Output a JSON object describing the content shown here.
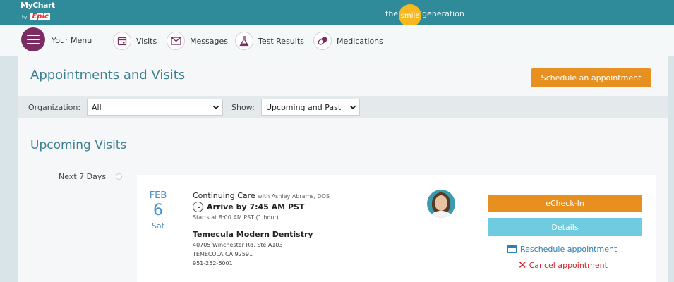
{
  "header": {
    "logo_mychart": "MyChart",
    "logo_by": "by",
    "logo_epic": "Epic",
    "brand_before": "the",
    "brand_smile": "smile",
    "brand_after": "generation"
  },
  "nav": {
    "menu_label": "Your Menu",
    "items": [
      {
        "label": "Visits",
        "icon": "calendar-icon"
      },
      {
        "label": "Messages",
        "icon": "envelope-icon"
      },
      {
        "label": "Test Results",
        "icon": "flask-icon"
      },
      {
        "label": "Medications",
        "icon": "pill-icon"
      }
    ]
  },
  "page": {
    "title": "Appointments and Visits",
    "schedule_button": "Schedule an appointment"
  },
  "filters": {
    "organization_label": "Organization:",
    "organization_value": "All",
    "show_label": "Show:",
    "show_value": "Upcoming and Past"
  },
  "upcoming": {
    "title": "Upcoming Visits",
    "timeline_label": "Next 7 Days"
  },
  "appointment": {
    "month": "FEB",
    "day": "6",
    "weekday": "Sat",
    "visit_type": "Continuing Care",
    "with_text": "with Ashley Abrams, DDS",
    "arrive": "Arrive by 7:45 AM PST",
    "starts": "Starts at 8:00 AM PST (1 hour)",
    "location_name": "Temecula Modern Dentistry",
    "address_line1": "40705 Winchester Rd, Ste A103",
    "address_line2": "TEMECULA CA 92591",
    "phone": "951-252-6001",
    "echeckin_button": "eCheck-In",
    "details_button": "Details",
    "reschedule_link": "Reschedule appointment",
    "cancel_link": "Cancel appointment"
  },
  "colors": {
    "header_teal": "#2f8a9a",
    "menu_purple": "#7b2c62",
    "accent_orange": "#e8901f",
    "details_blue": "#6ecbe0",
    "title_teal": "#3c7f93",
    "date_blue": "#4a90c8",
    "link_blue": "#2c7fb0",
    "cancel_red": "#d0262b"
  }
}
